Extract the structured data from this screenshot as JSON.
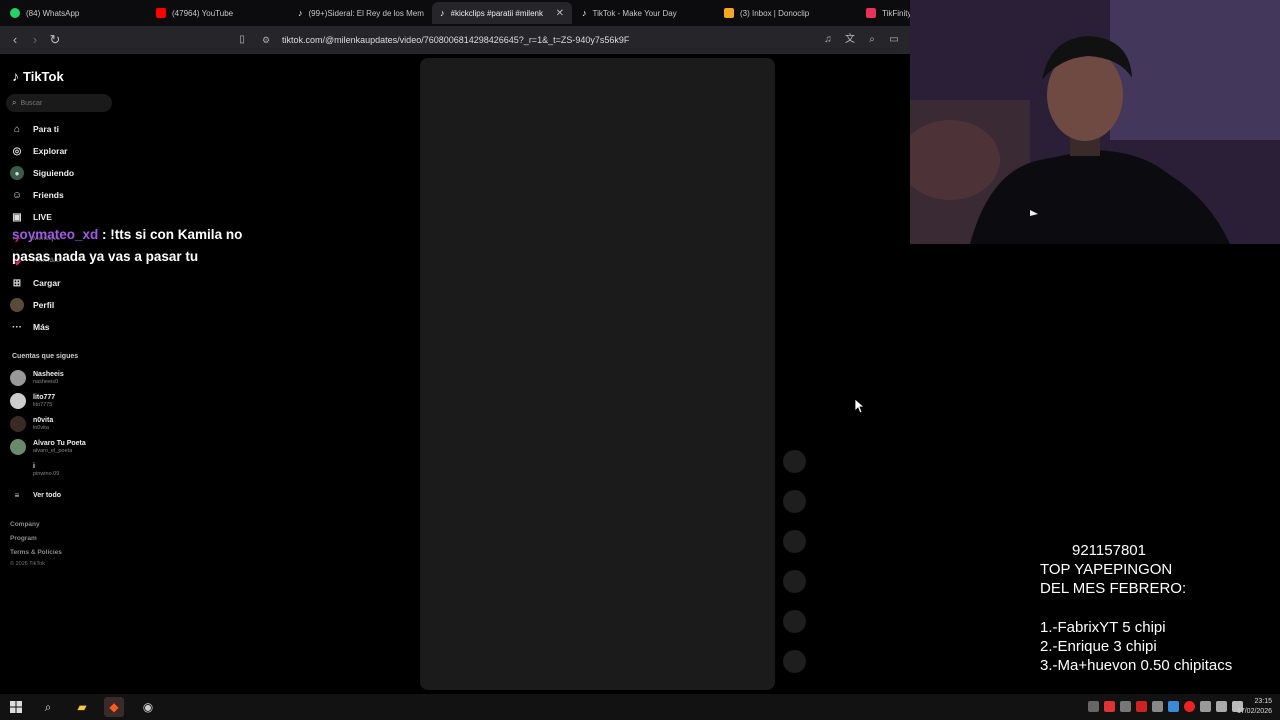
{
  "browser": {
    "tabs": [
      {
        "label": "(84) WhatsApp",
        "color": "#25D366"
      },
      {
        "label": "(47964) YouTube",
        "color": "#FF0000"
      },
      {
        "label": "(99+)Sideral: El Rey de los Mem",
        "color": "#ffffff"
      },
      {
        "label": "#kickclips #paratii #milenk",
        "color": "#ffffff"
      },
      {
        "label": "TikTok - Make Your Day",
        "color": "#ffffff"
      },
      {
        "label": "(3) Inbox | Donoclip",
        "color": "#f5a623"
      },
      {
        "label": "TikFinity",
        "color": "#e8325a"
      }
    ],
    "active_tab_close": "✕",
    "url": "tiktok.com/@milenkaupdates/video/7608006814298426645?_r=1&_t=ZS-940y7s56k9F"
  },
  "tiktok": {
    "logo": "TikTok",
    "search_placeholder": "Buscar",
    "nav": [
      {
        "label": "Para ti",
        "icon": "home-icon"
      },
      {
        "label": "Explorar",
        "icon": "compass-icon"
      },
      {
        "label": "Siguiendo",
        "icon": "following-icon"
      },
      {
        "label": "Friends",
        "icon": "friends-icon"
      },
      {
        "label": "LIVE",
        "icon": "live-icon"
      },
      {
        "label": "Mensajes",
        "icon": "messages-icon"
      },
      {
        "label": "Actividad",
        "icon": "activity-icon"
      },
      {
        "label": "Cargar",
        "icon": "upload-icon"
      },
      {
        "label": "Perfil",
        "icon": "profile-icon"
      },
      {
        "label": "Más",
        "icon": "more-icon"
      }
    ],
    "following_title": "Cuentas que sigues",
    "accounts": [
      {
        "name": "Nasheeis",
        "handle": "nasheeis0"
      },
      {
        "name": "lito777",
        "handle": "lito7775"
      },
      {
        "name": "n0vita",
        "handle": "in0vita"
      },
      {
        "name": "Alvaro Tu Poeta",
        "handle": "alvaro_el_poeta"
      },
      {
        "name": "i",
        "handle": "pinwino.09"
      }
    ],
    "see_all": "Ver todo",
    "footer": [
      "Company",
      "Program",
      "Terms & Policies"
    ],
    "copyright": "© 2026 TikTok"
  },
  "chat": {
    "user": "soymateo_xd",
    "message": " : !tts si con Kamila no pasas nada ya vas a pasar tu"
  },
  "donation_overlay": {
    "phone": "921157801",
    "title_line1": "TOP YAPEPINGON",
    "title_line2": "DEL MES FEBRERO:",
    "ranks": [
      "1.-FabrixYT 5 chipi",
      "2.-Enrique 3 chipi",
      "3.-Ma+huevon 0.50 chipitacs"
    ]
  },
  "taskbar": {
    "time": "23:15",
    "date": "17/02/2026"
  }
}
